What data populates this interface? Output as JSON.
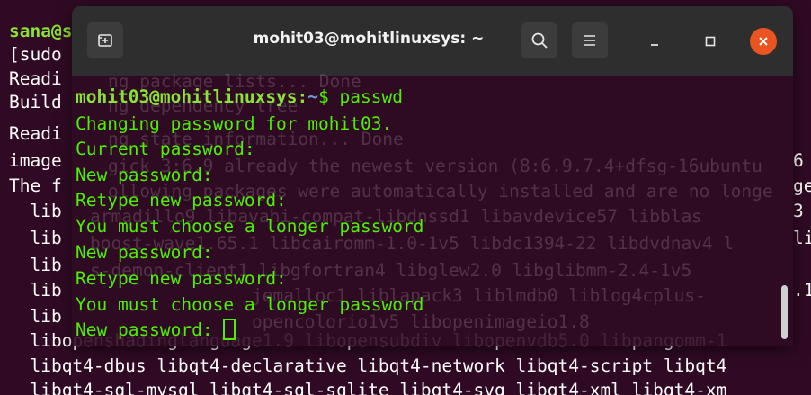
{
  "background_terminal": {
    "lines": [
      {
        "text": "sana@s",
        "style": "user"
      },
      {
        "text": "[sudo",
        "style": "normal"
      },
      {
        "text": "Readi",
        "style": "normal"
      },
      {
        "text": "Build",
        "style": "normal"
      },
      {
        "text": "Readi",
        "style": "normal"
      },
      {
        "text": "image",
        "style": "normal"
      },
      {
        "text": "The f",
        "style": "normal"
      },
      {
        "text": "  lib",
        "style": "normal"
      },
      {
        "text": "  lib",
        "style": "normal"
      },
      {
        "text": "  lib",
        "style": "normal"
      },
      {
        "text": "  lib",
        "style": "normal"
      },
      {
        "text": "  lib",
        "style": "normal"
      },
      {
        "text": "  libopenshadinglanguage1.9 libopensubdiv libopenvdb5.0 libpangomm-1",
        "style": "normal"
      },
      {
        "text": "  libqt4-dbus libqt4-declarative libqt4-network libqt4-script libqt4",
        "style": "normal"
      },
      {
        "text": "  libqt4-sql-mysql libqt4-sql-sqlite libqt4-svg libqt4-xml libqt4-xm",
        "style": "normal"
      }
    ],
    "right_edge": [
      "6",
      "ge",
      "3",
      "li",
      "",
      ".1"
    ],
    "ghost_text": [
      "ng package lists... Done",
      "ng dependency tree",
      "ng state information... Done",
      "gick 3:6.9 already the newest version (8:6.9.7.4+dfsg-16ubuntu",
      "ollowing packages were automatically installed and are no longe",
      "armadillo9 libavahi-compat-libdnssd1 libavdevice57 libblas",
      "boost-wave1.65.1 libcairomm-1.0-1v5 libdc1394-22 libdvdnav4 l",
      "s-demon-client1 libgfortran4 libglew2.0 libglibmm-2.4-1v5",
      "jemalloc1 liblapack3 liblmdb0 liblog4cplus-",
      "opencolorio1v5 libopenimageio1.8"
    ]
  },
  "window": {
    "title": "mohit03@mohitlinuxsys: ~",
    "icons": {
      "new_tab": "new-tab-icon",
      "search": "search-icon",
      "menu": "hamburger-menu-icon",
      "minimize": "minimize-icon",
      "maximize": "maximize-icon",
      "close": "close-icon"
    },
    "colors": {
      "titlebar": "#2e2e2e",
      "terminal_bg": "#300a24",
      "output_green": "#4df000",
      "prompt_user": "#8ae234",
      "prompt_path": "#729fcf",
      "close_button": "#e95420"
    }
  },
  "terminal": {
    "prompt_user": "mohit03@mohitlinuxsys",
    "prompt_colon": ":",
    "prompt_path": "~",
    "prompt_symbol": "$ ",
    "command": "passwd",
    "output": [
      "Changing password for mohit03.",
      "Current password:",
      "New password:",
      "Retype new password:",
      "You must choose a longer password",
      "New password:",
      "Retype new password:",
      "You must choose a longer password"
    ],
    "final_prompt": "New password: "
  }
}
